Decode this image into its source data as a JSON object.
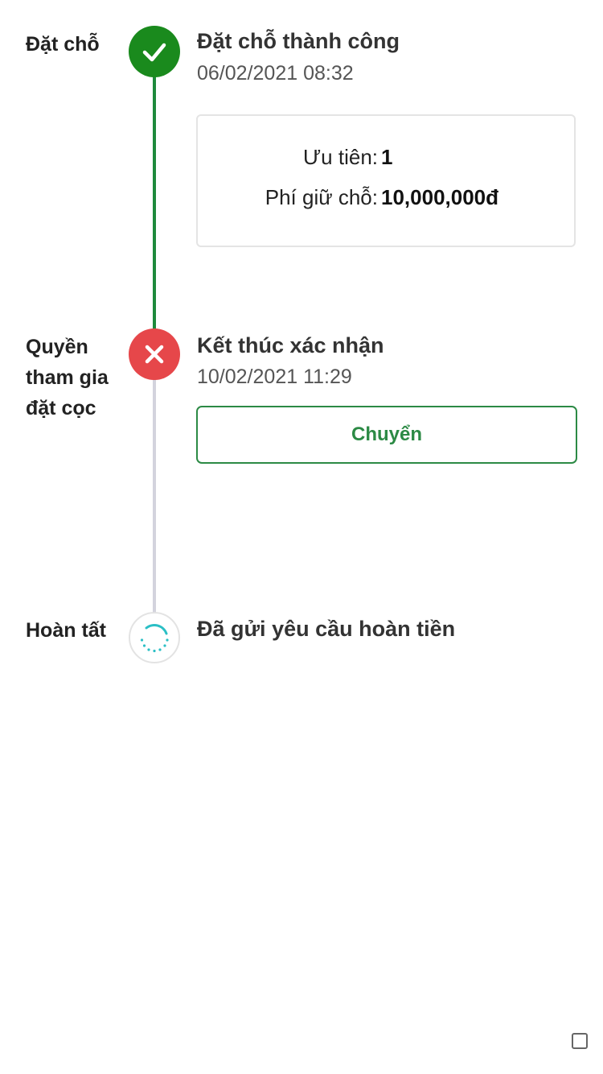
{
  "steps": [
    {
      "label": "Đặt chỗ",
      "status": "success",
      "title": "Đặt chỗ thành công",
      "date": "06/02/2021 08:32",
      "details": {
        "priority_label": "Ưu tiên:",
        "priority_value": "1",
        "fee_label": "Phí giữ chỗ:",
        "fee_value": "10,000,000đ"
      }
    },
    {
      "label_lines": [
        "Quyền",
        "tham gia",
        "đặt cọc"
      ],
      "status": "failed",
      "title": "Kết thúc xác nhận",
      "date": "10/02/2021 11:29",
      "action_label": "Chuyển"
    },
    {
      "label": "Hoàn tất",
      "status": "pending",
      "title": "Đã gửi yêu cầu hoàn tiền"
    }
  ],
  "colors": {
    "success": "#1a8a1d",
    "failed": "#e6474a",
    "pending_spinner": "#2bbfc5",
    "line_done": "#1e8a3c",
    "line_pending": "#d3d3dd",
    "button_border": "#2c8a45"
  },
  "icons": [
    "check-icon",
    "close-icon",
    "loading-icon",
    "checkbox-icon"
  ]
}
